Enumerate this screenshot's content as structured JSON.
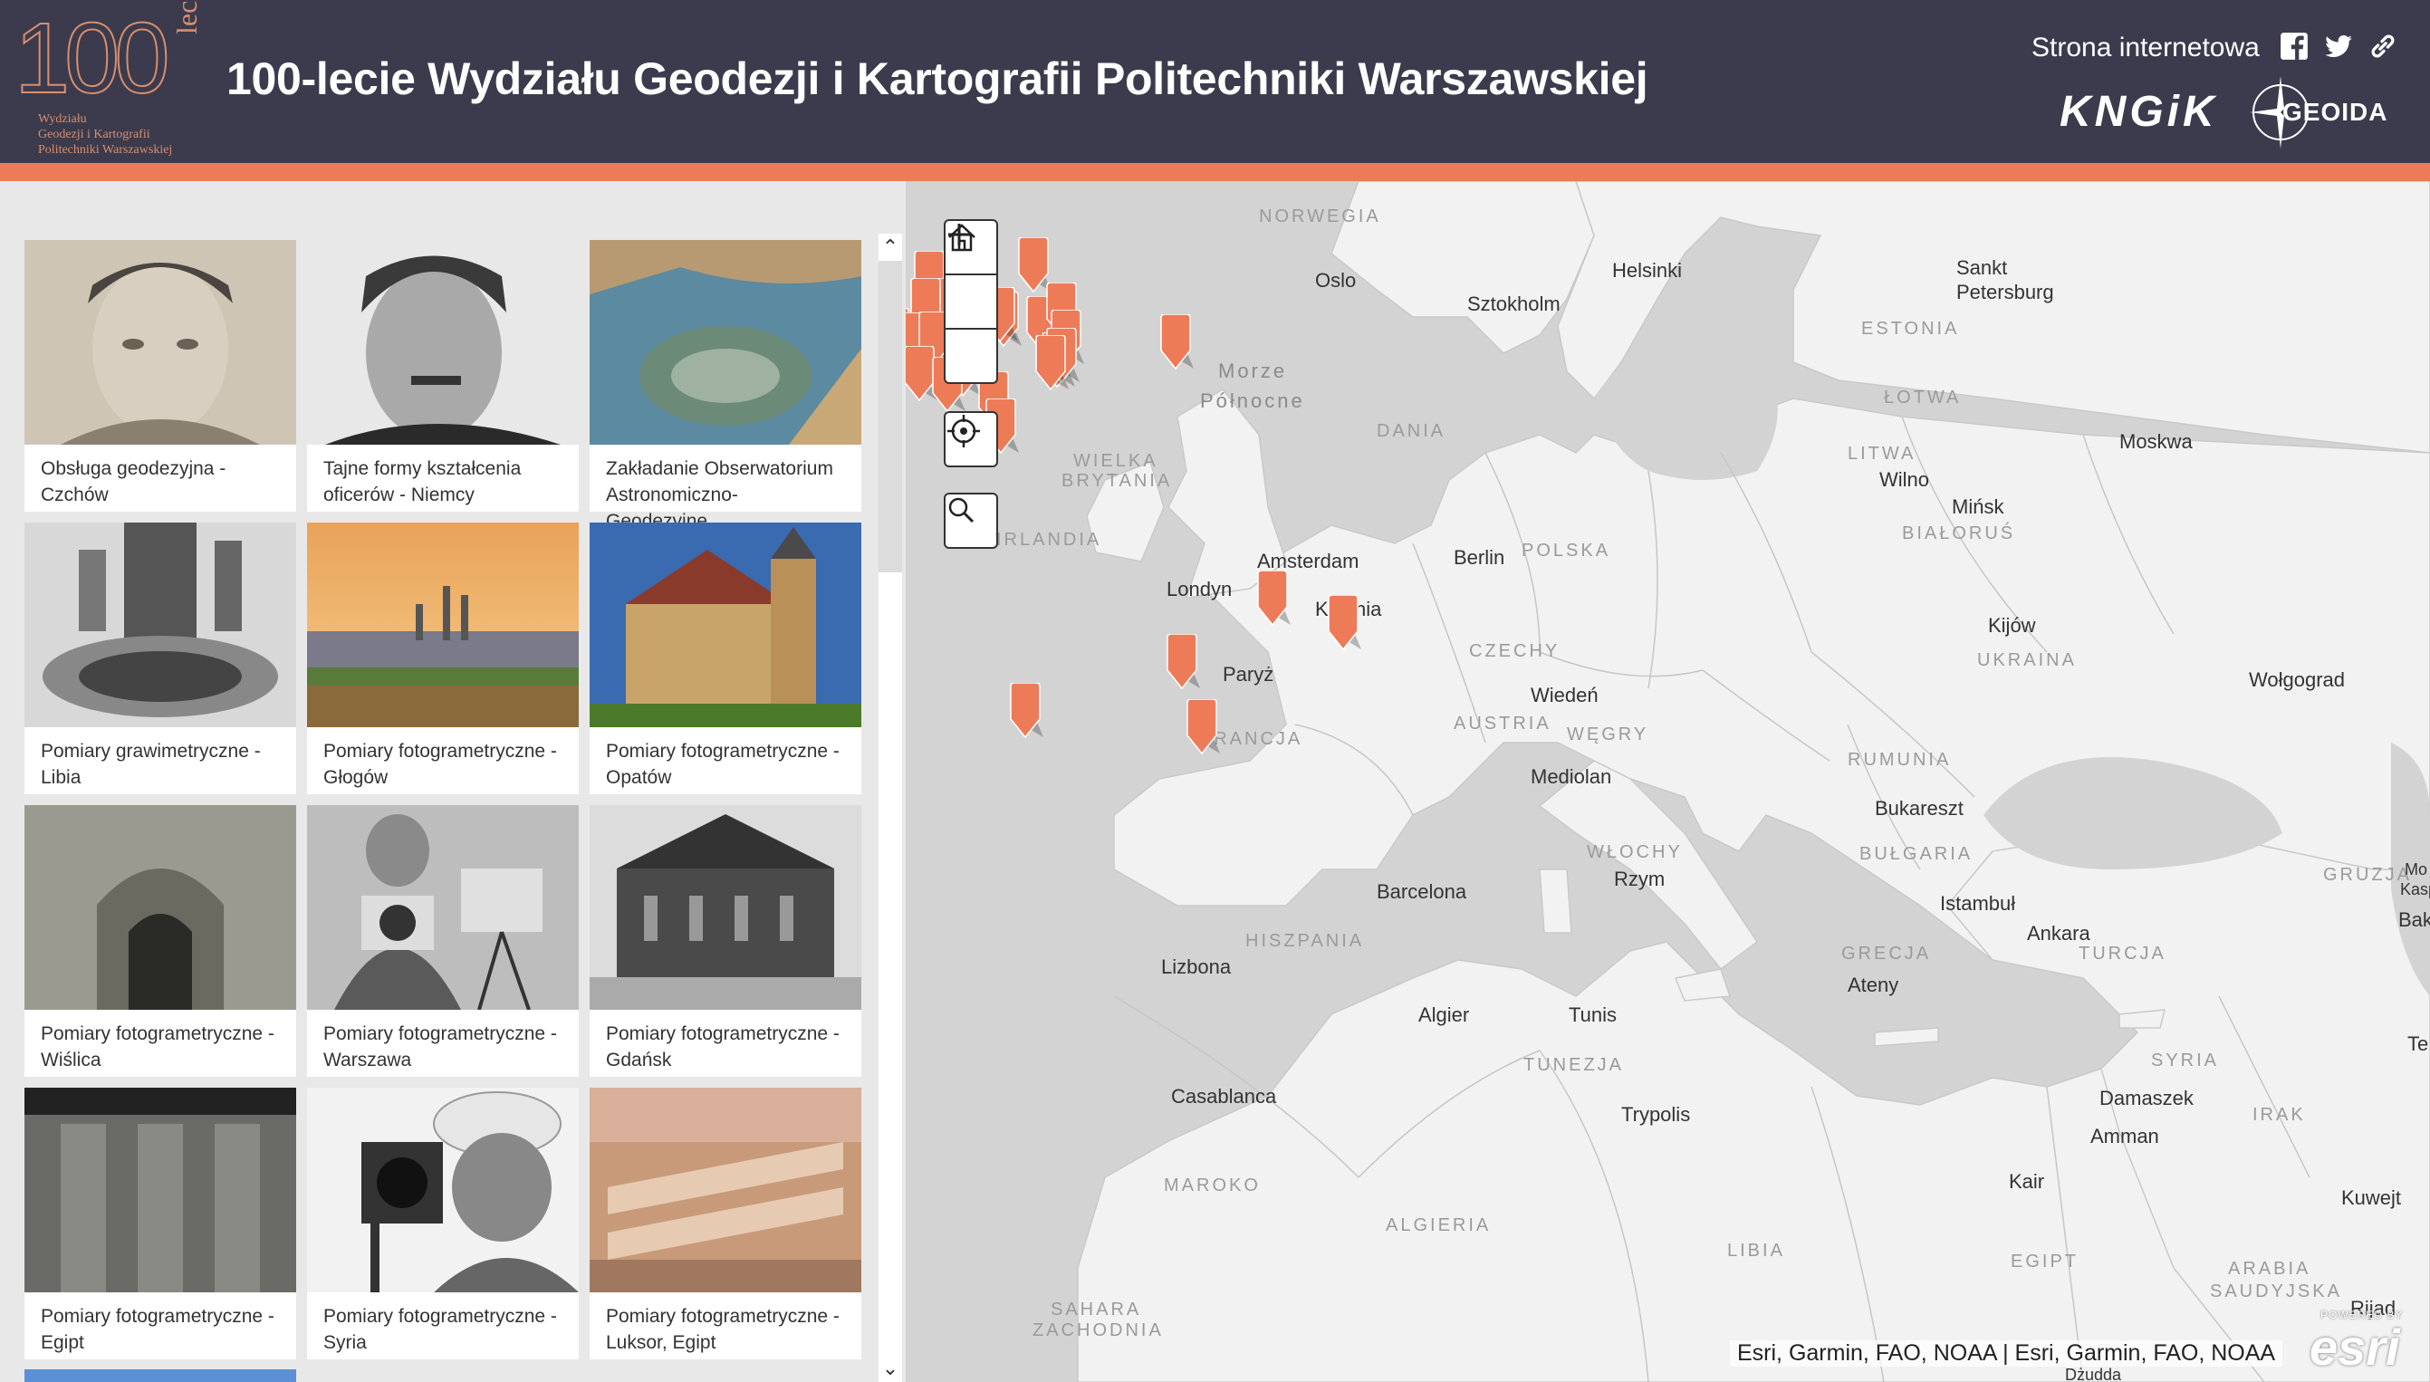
{
  "header": {
    "logo_number": "100",
    "logo_lecie": "lecie",
    "logo_subtitle": "Wydziału\nGeodezji i Kartografii\nPolitechniki Warszawskiej",
    "title": "100-lecie Wydziału Geodezji i Kartografii Politechniki Warszawskiej",
    "website_label": "Strona internetowa",
    "social_icons": [
      "facebook-icon",
      "twitter-icon",
      "link-icon"
    ],
    "brand_kngik": "KNGiK",
    "brand_geoida": "GEOIDA"
  },
  "colors": {
    "header_bg": "#3b3b4d",
    "accent": "#ee7b58",
    "pin": "#ee7b58",
    "land": "#f2f2f2",
    "water": "#d3d3d3"
  },
  "gallery": {
    "cards": [
      {
        "caption": "Obsługa geodezyjna - Czchów"
      },
      {
        "caption": "Tajne formy kształcenia oficerów - Niemcy"
      },
      {
        "caption": "Zakładanie Obserwatorium Astronomiczno-Geodezyjne..."
      },
      {
        "caption": "Pomiary grawimetryczne - Libia"
      },
      {
        "caption": "Pomiary fotogrametryczne - Głogów"
      },
      {
        "caption": "Pomiary fotogrametryczne - Opatów"
      },
      {
        "caption": "Pomiary fotogrametryczne - Wiślica"
      },
      {
        "caption": "Pomiary fotogrametryczne - Warszawa"
      },
      {
        "caption": "Pomiary fotogrametryczne - Gdańsk"
      },
      {
        "caption": "Pomiary fotogrametryczne - Egipt"
      },
      {
        "caption": "Pomiary fotogrametryczne - Syria"
      },
      {
        "caption": "Pomiary fotogrametryczne - Luksor, Egipt"
      }
    ]
  },
  "map": {
    "attribution": "Esri, Garmin, FAO, NOAA | Esri, Garmin, FAO, NOAA",
    "powered_by": "POWERED BY",
    "esri": "esri",
    "labels": {
      "norwegia": "NORWEGIA",
      "oslo": "Oslo",
      "sztokholm": "Sztokholm",
      "helsinki": "Helsinki",
      "sankt": "Sankt",
      "petersburg": "Petersburg",
      "estonia": "ESTONIA",
      "lotwa": "ŁOTWA",
      "litwa": "LITWA",
      "wilno": "Wilno",
      "minsk": "Mińsk",
      "bialorus": "BIAŁORUŚ",
      "moskwa": "Moskwa",
      "morze": "Morze",
      "polnocne": "Północne",
      "dania": "DANIA",
      "wielka": "WIELKA",
      "brytania": "BRYTANIA",
      "irlandia": "IRLANDIA",
      "londyn": "Londyn",
      "amsterdam": "Amsterdam",
      "berlin": "Berlin",
      "polska": "POLSKA",
      "kolonia": "Kolonia",
      "paryz": "Paryż",
      "czechy": "CZECHY",
      "wieden": "Wiedeń",
      "austria": "AUSTRIA",
      "wegry": "WĘGRY",
      "francja": "FRANCJA",
      "mediolan": "Mediolan",
      "kijow": "Kijów",
      "ukraina": "UKRAINA",
      "wolgograd": "Wołgograd",
      "rumunia": "RUMUNIA",
      "bukareszt": "Bukareszt",
      "wlochy": "WŁOCHY",
      "rzym": "Rzym",
      "bulgaria": "BUŁGARIA",
      "gruzja": "GRUZJA",
      "barcelona": "Barcelona",
      "hiszpania": "HISZPANIA",
      "lizbona": "Lizbona",
      "istambul": "Istambuł",
      "ankara": "Ankara",
      "turcja": "TURCJA",
      "grecja": "GRECJA",
      "ateny": "Ateny",
      "algier": "Algier",
      "tunis": "Tunis",
      "tunezja": "TUNEZJA",
      "casablanca": "Casablanca",
      "trypolis": "Trypolis",
      "maroko": "MAROKO",
      "algieria": "ALGIERIA",
      "libia": "LIBIA",
      "syria": "SYRIA",
      "damaszek": "Damaszek",
      "amman": "Amman",
      "irak": "IRAK",
      "kair": "Kair",
      "egipt": "EGIPT",
      "sahara": "SAHARA",
      "zachodnia": "ZACHODNIA",
      "kuwejt": "Kuwejt",
      "arabia": "ARABIA",
      "saudyjska": "SAUDYJSKA",
      "rijad": "Rijad",
      "baku": "Baku",
      "te": "Te",
      "mo": "Mo",
      "kasp": "Kasp",
      "dzudda": "Dżudda"
    }
  }
}
